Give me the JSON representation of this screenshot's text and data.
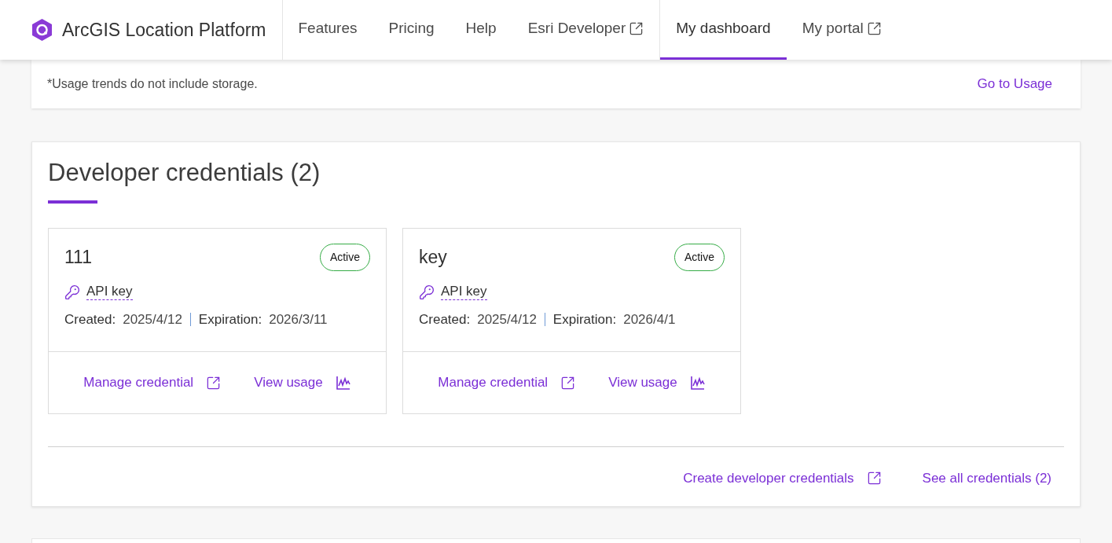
{
  "header": {
    "brand": "ArcGIS Location Platform",
    "nav": [
      {
        "label": "Features",
        "external": false,
        "selected": false
      },
      {
        "label": "Pricing",
        "external": false,
        "selected": false
      },
      {
        "label": "Help",
        "external": false,
        "selected": false
      },
      {
        "label": "Esri Developer",
        "external": true,
        "selected": false
      },
      {
        "label": "My dashboard",
        "external": false,
        "selected": true
      },
      {
        "label": "My portal",
        "external": true,
        "selected": false
      }
    ]
  },
  "usage_card": {
    "note": "*Usage trends do not include storage.",
    "link": "Go to Usage"
  },
  "credentials": {
    "title": "Developer credentials (2)",
    "items": [
      {
        "name": "111",
        "status": "Active",
        "type": "API key",
        "created_label": "Created:",
        "created": "2025/4/12",
        "expiration_label": "Expiration:",
        "expiration": "2026/3/11",
        "manage": "Manage credential",
        "usage": "View usage"
      },
      {
        "name": "key",
        "status": "Active",
        "type": "API key",
        "created_label": "Created:",
        "created": "2025/4/12",
        "expiration_label": "Expiration:",
        "expiration": "2026/4/1",
        "manage": "Manage credential",
        "usage": "View usage"
      }
    ],
    "actions": [
      {
        "label": "Create developer credentials",
        "external": true
      },
      {
        "label": "See all credentials (2)",
        "external": false
      }
    ]
  }
}
